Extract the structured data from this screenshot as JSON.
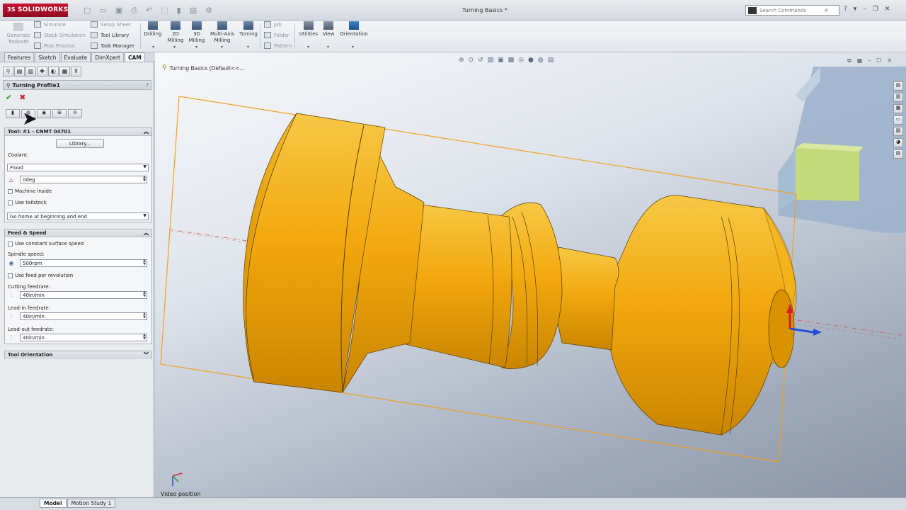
{
  "app": {
    "brand": "SOLIDWORKS",
    "brand_prefix": "3S",
    "document_title": "Turning Basics *"
  },
  "search": {
    "placeholder": "Search Commands"
  },
  "title_right": [
    "?",
    "▾",
    "–",
    "❐",
    "✕"
  ],
  "ribbon": {
    "generate": {
      "label_1": "Generate",
      "label_2": "Toolpath"
    },
    "col1": [
      {
        "label": "Simulate"
      },
      {
        "label": "Stock Simulation"
      },
      {
        "label": "Post Process"
      }
    ],
    "col2": [
      {
        "label": "Setup Sheet"
      },
      {
        "label": "Tool Library"
      },
      {
        "label": "Task Manager"
      }
    ],
    "big": [
      {
        "l1": "Drilling",
        "l2": ""
      },
      {
        "l1": "2D",
        "l2": "Milling"
      },
      {
        "l1": "3D",
        "l2": "Milling"
      },
      {
        "l1": "Multi-Axis",
        "l2": "Milling"
      },
      {
        "l1": "Turning",
        "l2": ""
      }
    ],
    "col3": [
      {
        "label": "Job"
      },
      {
        "label": "Folder"
      },
      {
        "label": "Pattern"
      }
    ],
    "big2": [
      {
        "l1": "Utilities"
      },
      {
        "l1": "View"
      },
      {
        "l1": "Orientation"
      }
    ]
  },
  "command_tabs": [
    {
      "label": "Features",
      "active": false
    },
    {
      "label": "Sketch",
      "active": false
    },
    {
      "label": "Evaluate",
      "active": false
    },
    {
      "label": "DimXpert",
      "active": false
    },
    {
      "label": "CAM",
      "active": true
    }
  ],
  "property_manager": {
    "title": "Turning Profile1",
    "help": "?",
    "tool_group": {
      "header": "Tool: #1 - CNMT 04701",
      "library_button": "Library...",
      "coolant_label": "Coolant:",
      "coolant_value": "Flood",
      "angle_value": "0deg",
      "machine_inside": "Machine inside",
      "use_tailstock": "Use tailstock",
      "home_value": "Go home at beginning and end"
    },
    "feed_group": {
      "header": "Feed & Speed",
      "constant_surface": "Use constant surface speed",
      "spindle_label": "Spindle speed:",
      "spindle_value": "500rpm",
      "feed_per_rev": "Use feed per revolution",
      "cutting_label": "Cutting feedrate:",
      "cutting_value": "40in/min",
      "leadin_label": "Lead-in feedrate:",
      "leadin_value": "40in/min",
      "leadout_label": "Lead-out feedrate:",
      "leadout_value": "40in/min"
    },
    "orientation_group": {
      "header": "Tool Orientation"
    }
  },
  "viewport": {
    "tree_label": "Turning Basics  (Default<<...",
    "video_position": "Video position",
    "part_color": "#f2b316",
    "stock_outline_color": "#f0a020"
  },
  "bottom_tabs": [
    {
      "label": "Model",
      "active": true
    },
    {
      "label": "Motion Study 1",
      "active": false
    }
  ]
}
